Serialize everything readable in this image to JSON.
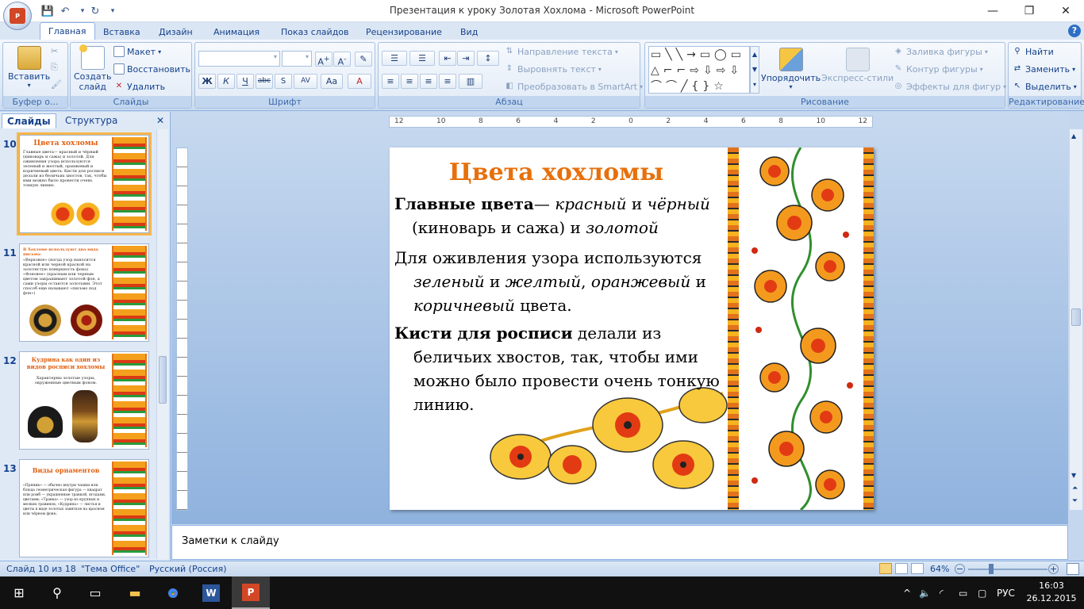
{
  "window": {
    "title": "Презентация к уроку Золотая Хохлома - Microsoft PowerPoint"
  },
  "tabs": [
    "Главная",
    "Вставка",
    "Дизайн",
    "Анимация",
    "Показ слайдов",
    "Рецензирование",
    "Вид"
  ],
  "ribbon": {
    "clipboard": {
      "label": "Буфер о...",
      "paste": "Вставить"
    },
    "slides": {
      "label": "Слайды",
      "new_slide": "Создать",
      "new_slide2": "слайд",
      "layout": "Макет",
      "reset": "Восстановить",
      "delete": "Удалить"
    },
    "font": {
      "label": "Шрифт"
    },
    "paragraph": {
      "label": "Абзац",
      "text_direction": "Направление текста",
      "align_text": "Выровнять текст",
      "smartart": "Преобразовать в SmartArt"
    },
    "drawing": {
      "label": "Рисование",
      "arrange": "Упорядочить",
      "quick_styles": "Экспресс-стили",
      "shape_fill": "Заливка фигуры",
      "shape_outline": "Контур фигуры",
      "shape_effects": "Эффекты для фигур"
    },
    "editing": {
      "label": "Редактирование",
      "find": "Найти",
      "replace": "Заменить",
      "select": "Выделить"
    }
  },
  "panel": {
    "tab_slides": "Слайды",
    "tab_outline": "Структура"
  },
  "thumbs": [
    {
      "num": "10",
      "title": "Цвета хохломы",
      "text": "Главные цвета— красный и чёрный (киноварь и сажа) и золотой. Для оживления узора используются зеленый и желтый, оранжевый и коричневый цвета. Кисти для росписи делали из беличьих хвостов, так, чтобы ими можно было провести очень тонкую линию."
    },
    {
      "num": "11",
      "title": "В Хохломе используют два вида письма:",
      "text": "«Верховое» (когда узор наносится красной или черной краской на золотистую поверхность фона) «Фоновое» (красным или черным цветом закрашивают золотой фон, а сами узоры остаются золотыми. Этот способ еще называют «письмо под фон»)"
    },
    {
      "num": "12",
      "title": "Кудрина как один из видов росписи хохломы",
      "text": "Характерны золотые узоры, окруженные цветным фоном."
    },
    {
      "num": "13",
      "title": "Виды орнаментов",
      "text": "«Пряник» — обычно внутри чашки или блюда геометрическая фигура — квадрат или ромб — украшенные травкой, ягодами, цветами; «Травка» — узор из крупных и мелких травинок; «Кудрина» — листья и цветы в виде золотых завитков на красном или чёрном фоне;"
    }
  ],
  "slide": {
    "title": "Цвета хохломы",
    "p1_bold": "Главные цвета",
    "p1_a": "— ",
    "p1_it1": "красный",
    "p1_b": " и ",
    "p1_it2": "чёрный",
    "p1_c": " (киноварь и сажа) и ",
    "p1_it3": "золотой",
    "p2_a": "Для оживления узора используются ",
    "p2_it1": "зеленый",
    "p2_b": " и ",
    "p2_it2": "желтый",
    "p2_c": ", ",
    "p2_it3": "оранжевый",
    "p2_d": " и ",
    "p2_it4": "коричневый",
    "p2_e": " цвета.",
    "p3_bold": "Кисти для росписи",
    "p3_a": " делали из беличьих хвостов, так, чтобы ими можно было провести очень тонкую линию."
  },
  "ruler_labels": [
    "12",
    "10",
    "8",
    "6",
    "4",
    "2",
    "0",
    "2",
    "4",
    "6",
    "8",
    "10",
    "12"
  ],
  "notes": {
    "placeholder": "Заметки к слайду"
  },
  "status": {
    "slide": "Слайд 10 из 18",
    "theme": "\"Тема Office\"",
    "lang": "Русский (Россия)",
    "zoom": "64%"
  },
  "tray": {
    "lang": "РУС",
    "time": "16:03",
    "date": "26.12.2015"
  }
}
